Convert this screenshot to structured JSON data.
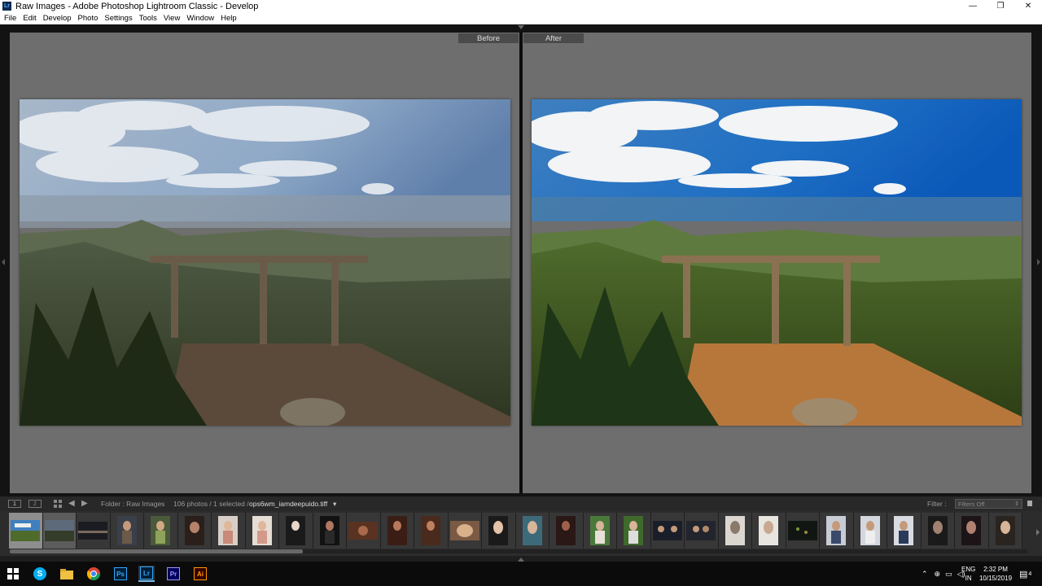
{
  "window": {
    "title": "Raw Images - Adobe Photoshop Lightroom Classic - Develop",
    "app_icon_text": "Lr",
    "minimize": "—",
    "maximize": "❐",
    "close": "✕"
  },
  "menu": [
    "File",
    "Edit",
    "Develop",
    "Photo",
    "Settings",
    "Tools",
    "View",
    "Window",
    "Help"
  ],
  "view": {
    "before_label": "Before",
    "after_label": "After"
  },
  "toolbar": {
    "monitor1": "1",
    "monitor2": "2",
    "folder": "Folder : Raw Images",
    "count": "106 photos / 1 selected /",
    "filename": "ops6wm_iamdeepuido.tiff",
    "filter_label": "Filter :",
    "filter_value": "Filters Off"
  },
  "taskbar": {
    "apps": [
      {
        "name": "start",
        "label": "⊞"
      },
      {
        "name": "skype",
        "label": "S"
      },
      {
        "name": "explorer",
        "label": ""
      },
      {
        "name": "chrome",
        "label": ""
      },
      {
        "name": "photoshop",
        "label": "Ps"
      },
      {
        "name": "lightroom",
        "label": "Lr"
      },
      {
        "name": "premiere",
        "label": "Pr"
      },
      {
        "name": "illustrator",
        "label": "Ai"
      }
    ],
    "lang_top": "ENG",
    "lang_bottom": "IN",
    "time": "2:32 PM",
    "date": "10/15/2019",
    "notification_count": "4"
  },
  "colors": {
    "workspace": "#131313",
    "pane": "#6e6e6e",
    "accent_ps": "#31a8ff",
    "accent_lr": "#31a8ff",
    "accent_pr": "#9999ff",
    "accent_ai": "#ff9a00"
  }
}
